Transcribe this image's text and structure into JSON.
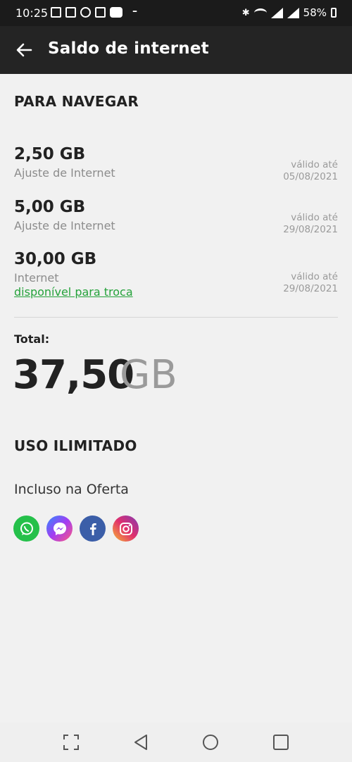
{
  "status_bar": {
    "time": "10:25",
    "battery": "58%"
  },
  "app_bar": {
    "title": "Saldo de internet",
    "back_icon": "arrow-left-icon"
  },
  "navigate_section": {
    "title": "PARA NAVEGAR",
    "balances": [
      {
        "amount": "2,50 GB",
        "type": "Ajuste de Internet",
        "valid_label": "válido até",
        "valid_date": "05/08/2021"
      },
      {
        "amount": "5,00 GB",
        "type": "Ajuste de Internet",
        "valid_label": "válido até",
        "valid_date": "29/08/2021"
      },
      {
        "amount": "30,00 GB",
        "type": "Internet",
        "link": "disponível para troca",
        "valid_label": "válido até",
        "valid_date": "29/08/2021"
      }
    ]
  },
  "total": {
    "label": "Total:",
    "value": "37,50",
    "unit": "GB"
  },
  "unlimited_section": {
    "title": "USO ILIMITADO",
    "subtitle": "Incluso na Oferta",
    "apps": [
      {
        "icon": "whatsapp-icon",
        "color": "#25c04a"
      },
      {
        "icon": "messenger-icon",
        "color": "#7b4dff"
      },
      {
        "icon": "facebook-icon",
        "color": "#3b5ea8"
      },
      {
        "icon": "instagram-icon",
        "color": "#d62e79"
      }
    ]
  },
  "nav_bar": {
    "icons": [
      "screenshot-icon",
      "back-triangle-icon",
      "home-circle-icon",
      "recents-square-icon"
    ]
  },
  "colors": {
    "accent_green": "#25a23b",
    "app_bar_bg": "#242424",
    "page_bg": "#f1f1f1"
  }
}
